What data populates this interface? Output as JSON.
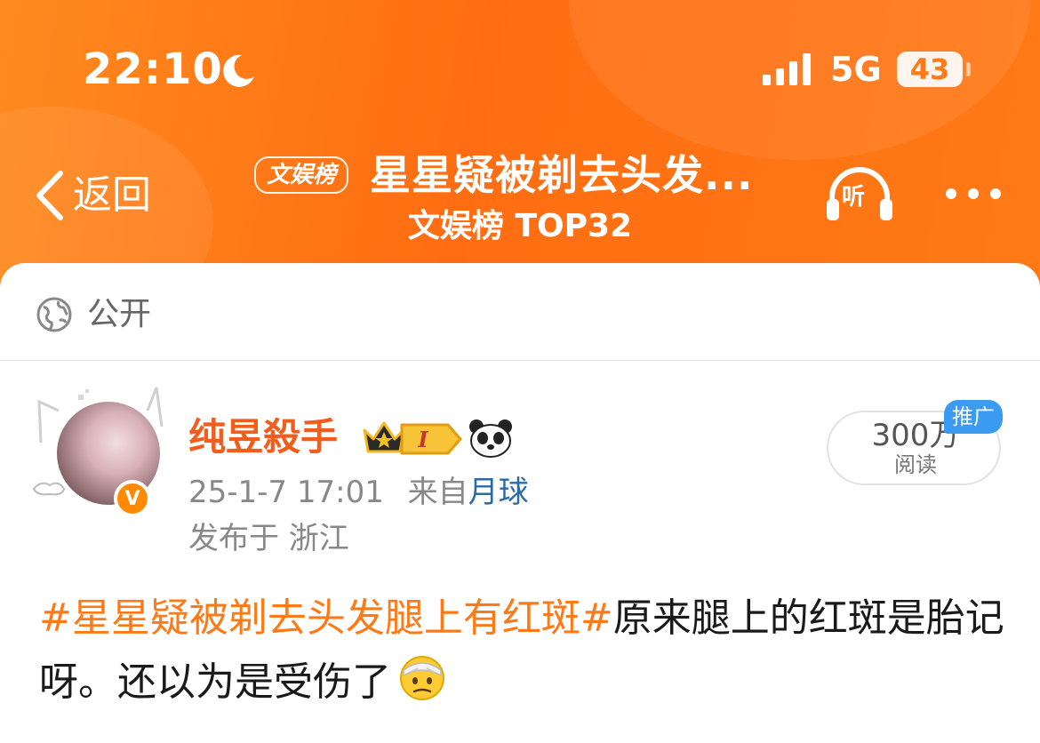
{
  "status_bar": {
    "time": "22:10",
    "network": "5G",
    "battery": "43",
    "icons": [
      "moon-icon",
      "signal-icon",
      "battery-icon"
    ]
  },
  "nav": {
    "back_label": "返回",
    "title_badge": "文娱榜",
    "title": "星星疑被剃去头发...",
    "subtitle": "文娱榜 TOP32",
    "listen_label": "听",
    "icons": [
      "back-chevron-icon",
      "headphones-icon",
      "more-icon"
    ]
  },
  "visibility": {
    "label": "公开",
    "icon": "globe-icon"
  },
  "post": {
    "author": {
      "name": "纯昱殺手",
      "verified_mark": "V",
      "level": "I",
      "icons": [
        "crown-icon",
        "panda-icon"
      ]
    },
    "timestamp": "25-1-7 17:01",
    "source_prefix": "来自",
    "source": "月球",
    "location": "发布于 浙江",
    "reads": {
      "count": "300万",
      "label": "阅读",
      "promo": "推广"
    },
    "hashtag": "#星星疑被剃去头发腿上有红斑#",
    "body": "原来腿上的红斑是胎记呀。还以为是受伤了",
    "emoji": "injured-face-emoji"
  },
  "colors": {
    "header_orange": "#ff6d12",
    "hashtag_orange": "#ff7a16",
    "username_orange": "#f15d1c",
    "source_blue": "#2b6aa8",
    "promo_blue": "#3b9bf0"
  }
}
